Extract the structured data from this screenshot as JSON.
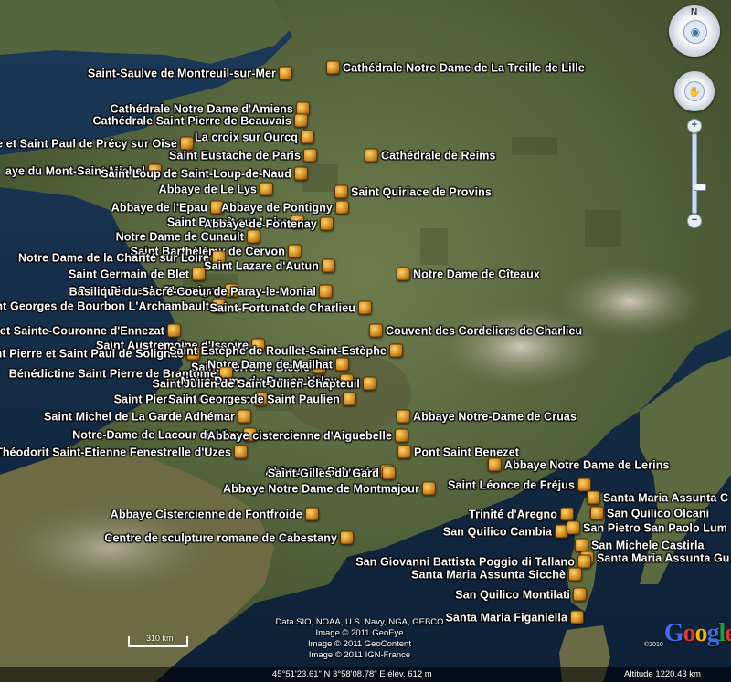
{
  "map": {
    "places": [
      {
        "name": "Saint-Saulve de Montreuil-sur-Mer",
        "side": "left"
      },
      {
        "name": "Cathédrale Notre Dame de La Treille de Lille",
        "side": "right"
      },
      {
        "name": "Cathédrale Notre Dame d'Amiens",
        "side": "left"
      },
      {
        "name": "Cathédrale Saint Pierre de Beauvais",
        "side": "left"
      },
      {
        "name": "Saint Pierre et Saint Paul de Précy sur Oise",
        "side": "left"
      },
      {
        "name": "La croix sur Ourcq",
        "side": "left"
      },
      {
        "name": "Saint Eustache de Paris",
        "side": "left"
      },
      {
        "name": "Cathédrale de Reims",
        "side": "right"
      },
      {
        "name": "aye du Mont-Saint-Michel",
        "side": "left"
      },
      {
        "name": "Saint Loup de Saint-Loup-de-Naud",
        "side": "left"
      },
      {
        "name": "Abbaye de Le Lys",
        "side": "left"
      },
      {
        "name": "Saint Quiriace de Provins",
        "side": "right"
      },
      {
        "name": "Abbaye de l'Epau",
        "side": "left"
      },
      {
        "name": "Abbaye de Pontigny",
        "side": "left"
      },
      {
        "name": "Saint Benoît sur Loire",
        "side": "left"
      },
      {
        "name": "Abbaye de Fontenay",
        "side": "left"
      },
      {
        "name": "Notre Dame de Cunault",
        "side": "left"
      },
      {
        "name": "Saint Barthélémy de Cervon",
        "side": "left"
      },
      {
        "name": "Notre Dame de la Charité sur Loire",
        "side": "left"
      },
      {
        "name": "Saint Lazare d'Autun",
        "side": "left"
      },
      {
        "name": "Saint Germain de Blet",
        "side": "left"
      },
      {
        "name": "Notre Dame de Cîteaux",
        "side": "right"
      },
      {
        "name": "Saint Pierre de Chauvigny",
        "side": "left"
      },
      {
        "name": "Basilique du Sacré-Coeur de Paray-le-Monial",
        "side": "left"
      },
      {
        "name": "Saint Georges de Bourbon L'Archambault",
        "side": "left"
      },
      {
        "name": "Saint-Fortunat de Charlieu",
        "side": "left"
      },
      {
        "name": "Collégiale Saint-Victor et Sainte-Couronne d'Ennezat",
        "side": "left"
      },
      {
        "name": "Couvent des Cordeliers de Charlieu",
        "side": "right"
      },
      {
        "name": "Saint Austremoine d'Issoire",
        "side": "left"
      },
      {
        "name": "Saint Pierre et Saint Paul de Solignac",
        "side": "left"
      },
      {
        "name": "Saint Estèphe de Roullet-Saint-Estèphe",
        "side": "left"
      },
      {
        "name": "Saint Pierre de Blesle",
        "side": "left"
      },
      {
        "name": "Notre Dame de Mailhat",
        "side": "left"
      },
      {
        "name": "Bénédictine Saint Pierre de Brantome",
        "side": "left"
      },
      {
        "name": "Notre Dame du Puy en Velay",
        "side": "left"
      },
      {
        "name": "Saint Julien de Saint-Julien-Chapteuil",
        "side": "left"
      },
      {
        "name": "Saint Pierre de Carennac",
        "side": "left"
      },
      {
        "name": "Saint Georges de Saint Paulien",
        "side": "left"
      },
      {
        "name": "Saint Michel de La Garde Adhémar",
        "side": "left"
      },
      {
        "name": "Abbaye Notre-Dame de Cruas",
        "side": "right"
      },
      {
        "name": "Notre-Dame de Lacour de Visa",
        "side": "left"
      },
      {
        "name": "Abbaye cistercienne d'Aiguebelle",
        "side": "left"
      },
      {
        "name": "Saint-Théodorit Saint-Etienne Fenestrelle d'Uzes",
        "side": "left"
      },
      {
        "name": "Pont Saint Benezet",
        "side": "right"
      },
      {
        "name": "Abbaye Notre Dame de Lerins",
        "side": "right"
      },
      {
        "name": "Abbaye de Sylvanès",
        "side": "left"
      },
      {
        "name": "Saint-Gilles du Gard",
        "side": "left"
      },
      {
        "name": "Saint Léonce de Fréjus",
        "side": "left"
      },
      {
        "name": "Abbaye Notre Dame  de Montmajour",
        "side": "left"
      },
      {
        "name": "Santa Maria Assunta C",
        "side": "right"
      },
      {
        "name": "Trinité d'Aregno",
        "side": "left"
      },
      {
        "name": "San Quilico Olcani",
        "side": "right"
      },
      {
        "name": "Abbaye Cistercienne de Fontfroide",
        "side": "left"
      },
      {
        "name": "San Quilico Cambia",
        "side": "left"
      },
      {
        "name": "San Pietro San Paolo Lum",
        "side": "right"
      },
      {
        "name": "Centre de sculpture romane de Cabestany",
        "side": "left"
      },
      {
        "name": "San Michele Castirla",
        "side": "right"
      },
      {
        "name": "Santa Maria Assunta Gu",
        "side": "right"
      },
      {
        "name": "San Giovanni Battista Poggio di Tallano",
        "side": "left"
      },
      {
        "name": "Santa Maria Assunta Sicchè",
        "side": "left"
      },
      {
        "name": "San Quilico Montilati",
        "side": "left"
      },
      {
        "name": "Santa Maria Figaniella",
        "side": "left"
      }
    ]
  },
  "credits": {
    "line1": "Data SIO, NOAA, U.S. Navy, NGA, GEBCO",
    "line2": "Image © 2011 GeoEye",
    "line3": "Image © 2011 GeoContent",
    "line4": "Image © 2011 IGN-France"
  },
  "brand": {
    "year": "©2010",
    "logo": "Google",
    "colors": [
      "#3b6fe8",
      "#e3352b",
      "#f5b400",
      "#3b6fe8",
      "#1e9e3f",
      "#e3352b"
    ]
  },
  "scale": {
    "label": "310 km"
  },
  "status": {
    "coordinates": "45°51'23.61\" N    3°58'08.78\" E  élév.  612 m",
    "altitude": "Altitude  1220.43 km"
  },
  "nav": {
    "north": "N",
    "look_icon": "eye-icon",
    "move_icon": "hand-icon",
    "zoom_in": "+",
    "zoom_out": "−"
  }
}
